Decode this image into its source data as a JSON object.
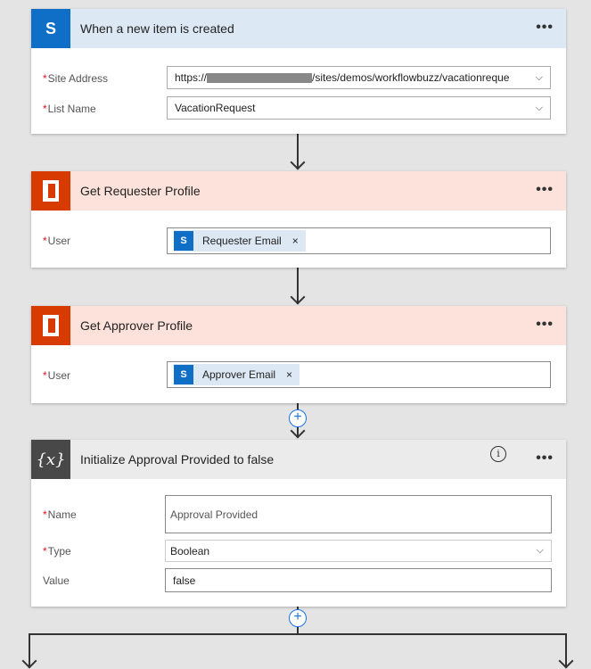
{
  "trigger": {
    "title": "When a new item is created",
    "site_label": "Site Address",
    "site_prefix": "https://",
    "site_suffix": "/sites/demos/workflowbuzz/vacationreque",
    "list_label": "List Name",
    "list_value": "VacationRequest",
    "more": "•••"
  },
  "requester": {
    "title": "Get Requester Profile",
    "user_label": "User",
    "token": "Requester Email",
    "more": "•••"
  },
  "approver": {
    "title": "Get Approver Profile",
    "user_label": "User",
    "token": "Approver Email",
    "more": "•••"
  },
  "init": {
    "title": "Initialize Approval Provided to false",
    "name_label": "Name",
    "name_value": "Approval Provided",
    "type_label": "Type",
    "type_value": "Boolean",
    "value_label": "Value",
    "value_value": "false",
    "more": "•••",
    "icon_text": "{x}"
  },
  "common": {
    "required": "*",
    "remove": "×",
    "sp_letter": "S",
    "plus": "+"
  },
  "colors": {
    "sharepoint": "#0f6fc6",
    "office": "#d83b01",
    "variable": "#484848"
  }
}
